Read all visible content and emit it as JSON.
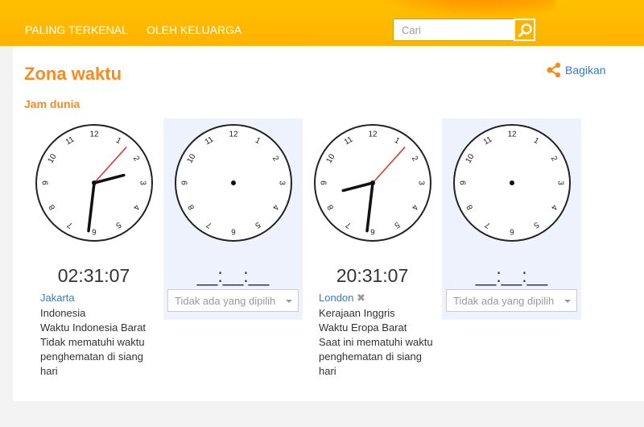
{
  "nav": {
    "items": [
      "PALING TERKENAL",
      "OLEH KELUARGA"
    ]
  },
  "search": {
    "placeholder": "Cari"
  },
  "page": {
    "title": "Zona waktu",
    "share_label": "Bagikan",
    "section_title": "Jam dunia"
  },
  "colors": {
    "brand": "#ffb300",
    "accent_orange": "#f68b1f",
    "link": "#2a7fd0",
    "second_hand": "#e53935",
    "empty_panel": "#eef2fc"
  },
  "clock_numerals": [
    "12",
    "1",
    "2",
    "3",
    "4",
    "5",
    "6",
    "7",
    "8",
    "9",
    "10",
    "11"
  ],
  "clocks": [
    {
      "time": "02:31:07",
      "hour": 2,
      "minute": 31,
      "second": 7,
      "city": "Jakarta",
      "removable": false,
      "info": [
        "Indonesia",
        "Waktu Indonesia Barat",
        "Tidak mematuhi waktu penghematan di siang hari"
      ]
    },
    {
      "empty": true,
      "time": "__:__:__",
      "select_label": "Tidak ada yang dipilih"
    },
    {
      "time": "20:31:07",
      "hour": 20,
      "minute": 31,
      "second": 7,
      "city": "London",
      "removable": true,
      "info": [
        "Kerajaan Inggris",
        "Waktu Eropa Barat",
        "Saat ini mematuhi waktu penghematan di siang hari"
      ]
    },
    {
      "empty": true,
      "time": "__:__:__",
      "select_label": "Tidak ada yang dipilih"
    }
  ],
  "icons": {
    "search": "magnifier-icon",
    "share": "share-icon",
    "remove": "close-icon",
    "select": "caret-down-icon"
  }
}
